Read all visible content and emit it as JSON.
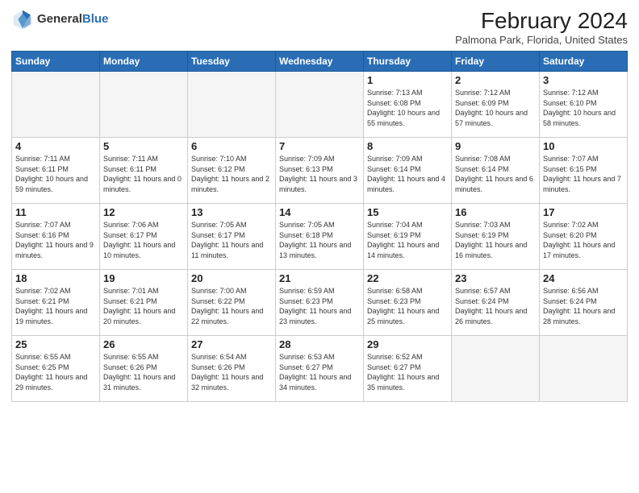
{
  "header": {
    "logo_general": "General",
    "logo_blue": "Blue",
    "month_title": "February 2024",
    "location": "Palmona Park, Florida, United States"
  },
  "days_of_week": [
    "Sunday",
    "Monday",
    "Tuesday",
    "Wednesday",
    "Thursday",
    "Friday",
    "Saturday"
  ],
  "weeks": [
    [
      {
        "day": "",
        "empty": true
      },
      {
        "day": "",
        "empty": true
      },
      {
        "day": "",
        "empty": true
      },
      {
        "day": "",
        "empty": true
      },
      {
        "day": "1",
        "sunrise": "7:13 AM",
        "sunset": "6:08 PM",
        "daylight": "10 hours and 55 minutes."
      },
      {
        "day": "2",
        "sunrise": "7:12 AM",
        "sunset": "6:09 PM",
        "daylight": "10 hours and 57 minutes."
      },
      {
        "day": "3",
        "sunrise": "7:12 AM",
        "sunset": "6:10 PM",
        "daylight": "10 hours and 58 minutes."
      }
    ],
    [
      {
        "day": "4",
        "sunrise": "7:11 AM",
        "sunset": "6:11 PM",
        "daylight": "10 hours and 59 minutes."
      },
      {
        "day": "5",
        "sunrise": "7:11 AM",
        "sunset": "6:11 PM",
        "daylight": "11 hours and 0 minutes."
      },
      {
        "day": "6",
        "sunrise": "7:10 AM",
        "sunset": "6:12 PM",
        "daylight": "11 hours and 2 minutes."
      },
      {
        "day": "7",
        "sunrise": "7:09 AM",
        "sunset": "6:13 PM",
        "daylight": "11 hours and 3 minutes."
      },
      {
        "day": "8",
        "sunrise": "7:09 AM",
        "sunset": "6:14 PM",
        "daylight": "11 hours and 4 minutes."
      },
      {
        "day": "9",
        "sunrise": "7:08 AM",
        "sunset": "6:14 PM",
        "daylight": "11 hours and 6 minutes."
      },
      {
        "day": "10",
        "sunrise": "7:07 AM",
        "sunset": "6:15 PM",
        "daylight": "11 hours and 7 minutes."
      }
    ],
    [
      {
        "day": "11",
        "sunrise": "7:07 AM",
        "sunset": "6:16 PM",
        "daylight": "11 hours and 9 minutes."
      },
      {
        "day": "12",
        "sunrise": "7:06 AM",
        "sunset": "6:17 PM",
        "daylight": "11 hours and 10 minutes."
      },
      {
        "day": "13",
        "sunrise": "7:05 AM",
        "sunset": "6:17 PM",
        "daylight": "11 hours and 11 minutes."
      },
      {
        "day": "14",
        "sunrise": "7:05 AM",
        "sunset": "6:18 PM",
        "daylight": "11 hours and 13 minutes."
      },
      {
        "day": "15",
        "sunrise": "7:04 AM",
        "sunset": "6:19 PM",
        "daylight": "11 hours and 14 minutes."
      },
      {
        "day": "16",
        "sunrise": "7:03 AM",
        "sunset": "6:19 PM",
        "daylight": "11 hours and 16 minutes."
      },
      {
        "day": "17",
        "sunrise": "7:02 AM",
        "sunset": "6:20 PM",
        "daylight": "11 hours and 17 minutes."
      }
    ],
    [
      {
        "day": "18",
        "sunrise": "7:02 AM",
        "sunset": "6:21 PM",
        "daylight": "11 hours and 19 minutes."
      },
      {
        "day": "19",
        "sunrise": "7:01 AM",
        "sunset": "6:21 PM",
        "daylight": "11 hours and 20 minutes."
      },
      {
        "day": "20",
        "sunrise": "7:00 AM",
        "sunset": "6:22 PM",
        "daylight": "11 hours and 22 minutes."
      },
      {
        "day": "21",
        "sunrise": "6:59 AM",
        "sunset": "6:23 PM",
        "daylight": "11 hours and 23 minutes."
      },
      {
        "day": "22",
        "sunrise": "6:58 AM",
        "sunset": "6:23 PM",
        "daylight": "11 hours and 25 minutes."
      },
      {
        "day": "23",
        "sunrise": "6:57 AM",
        "sunset": "6:24 PM",
        "daylight": "11 hours and 26 minutes."
      },
      {
        "day": "24",
        "sunrise": "6:56 AM",
        "sunset": "6:24 PM",
        "daylight": "11 hours and 28 minutes."
      }
    ],
    [
      {
        "day": "25",
        "sunrise": "6:55 AM",
        "sunset": "6:25 PM",
        "daylight": "11 hours and 29 minutes."
      },
      {
        "day": "26",
        "sunrise": "6:55 AM",
        "sunset": "6:26 PM",
        "daylight": "11 hours and 31 minutes."
      },
      {
        "day": "27",
        "sunrise": "6:54 AM",
        "sunset": "6:26 PM",
        "daylight": "11 hours and 32 minutes."
      },
      {
        "day": "28",
        "sunrise": "6:53 AM",
        "sunset": "6:27 PM",
        "daylight": "11 hours and 34 minutes."
      },
      {
        "day": "29",
        "sunrise": "6:52 AM",
        "sunset": "6:27 PM",
        "daylight": "11 hours and 35 minutes."
      },
      {
        "day": "",
        "empty": true
      },
      {
        "day": "",
        "empty": true
      }
    ]
  ]
}
